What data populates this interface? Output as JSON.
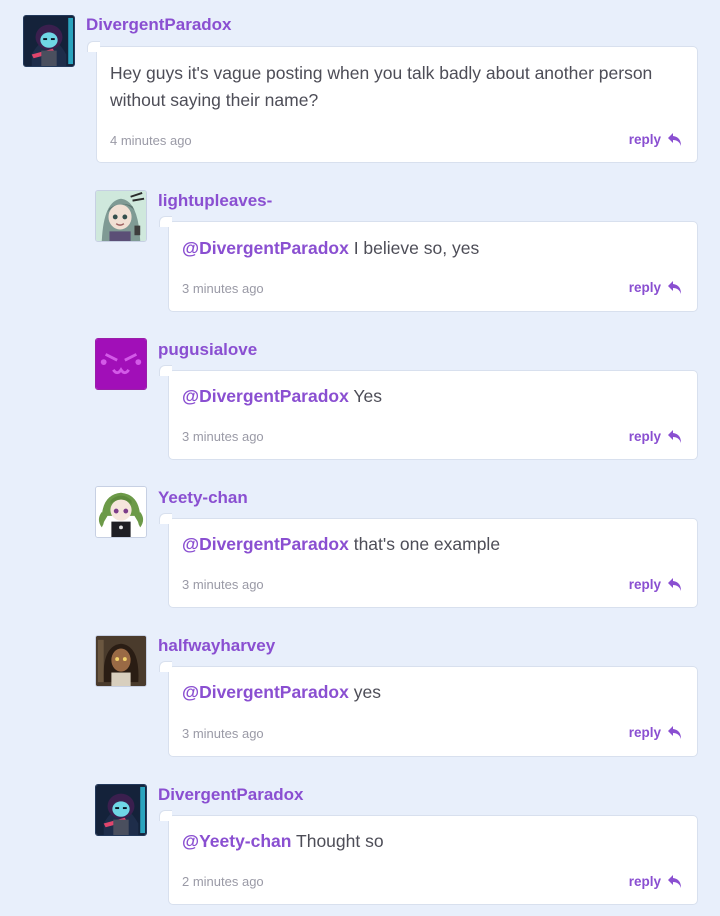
{
  "comments": [
    {
      "user": "DivergentParadox",
      "mention": "",
      "text": "Hey guys it's vague posting when you talk badly about another person without saying their name?",
      "time": "4 minutes ago",
      "reply_label": "reply",
      "avatar_icon": "divergent-paradox-avatar"
    },
    {
      "user": "lightupleaves-",
      "mention": "@DivergentParadox",
      "text": " I believe so, yes",
      "time": "3 minutes ago",
      "reply_label": "reply",
      "avatar_icon": "lightupleaves-avatar"
    },
    {
      "user": "pugusialove",
      "mention": "@DivergentParadox",
      "text": " Yes",
      "time": "3 minutes ago",
      "reply_label": "reply",
      "avatar_icon": "pugusialove-avatar"
    },
    {
      "user": "Yeety-chan",
      "mention": "@DivergentParadox",
      "text": " that's one example",
      "time": "3 minutes ago",
      "reply_label": "reply",
      "avatar_icon": "yeety-chan-avatar"
    },
    {
      "user": "halfwayharvey",
      "mention": "@DivergentParadox",
      "text": " yes",
      "time": "3 minutes ago",
      "reply_label": "reply",
      "avatar_icon": "halfwayharvey-avatar"
    },
    {
      "user": "DivergentParadox",
      "mention": "@Yeety-chan",
      "text": " Thought so",
      "time": "2 minutes ago",
      "reply_label": "reply",
      "avatar_icon": "divergent-paradox-avatar"
    }
  ],
  "colors": {
    "background": "#e8effb",
    "accent": "#8a4fd1",
    "body_text": "#4d4d57",
    "meta_text": "#9a9aa6"
  }
}
